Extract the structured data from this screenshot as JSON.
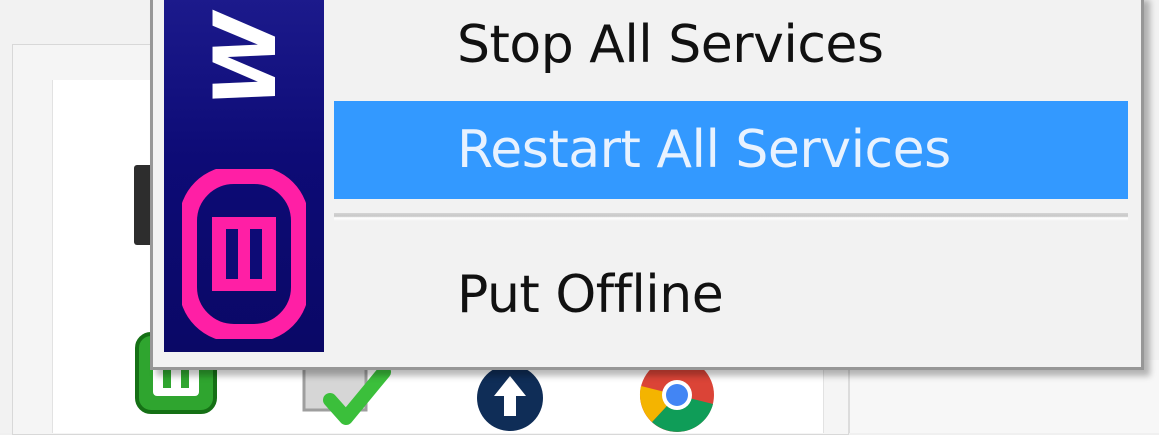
{
  "menu": {
    "banner_text": "W",
    "items": [
      {
        "label": "Stop All Services",
        "highlighted": false
      },
      {
        "label": "Restart All Services",
        "highlighted": true
      },
      {
        "label": "Put Offline",
        "highlighted": false
      }
    ],
    "highlight_color": "#3399ff",
    "banner_color": "#0d0b76",
    "logo_color": "#ff1fa5"
  },
  "tray": {
    "icons": [
      "wampserver-green-icon",
      "checkmark-icon",
      "upload-arrow-icon",
      "chrome-icon"
    ]
  }
}
